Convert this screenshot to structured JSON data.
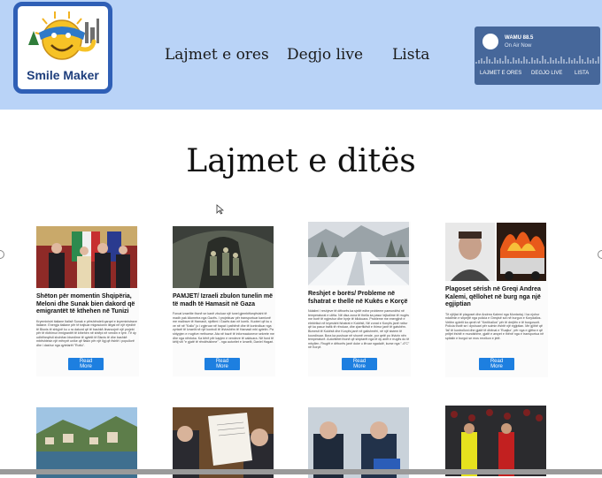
{
  "brand": {
    "name": "Smile Maker"
  },
  "nav": [
    "Lajmet e ores",
    "Degjo live",
    "Lista"
  ],
  "player": {
    "station": "WAMU 88.5",
    "status": "On Air Now",
    "links": [
      "LAJMET E ORES",
      "DEGJO LIVE",
      "LISTA"
    ]
  },
  "section": {
    "title": "Lajmet e ditës"
  },
  "cards": [
    {
      "title": "Shëton për momentin Shqipëria, Meloni dhe Sunak bien dakord që emigrantët të kthehen në Tunizi",
      "body": "Kryeministri italiane Italisë Sunak e përshëndeti qarqet e kryeministrave italiane. Energja italiane për të trajtuar migracionin ilegal në një rrjedhë të Bisnis të shtyjnë ku u ra dakord që të bashkë-financojnë një projekt për të rikthimur emigrantët të kthehen në shtëpi në vendin e tyre. Të dy udhëheqësit shohëan bisedime të qytetit të Bisnis të dhe bashkë mbështesin një mënyrë unike që flasin për një ligj që është i popullorë dhe i dashur nga qytetarët \"Ruttu\".",
      "button": "Read More"
    },
    {
      "title": "PAMJET/ Izraeli zbulon tunelin më të madh të Hamasit në Gaza",
      "body": "Forcat izraelite thonë se kanë zbuluar një tunel gjembëkeqësisht të madh pak kilometra nga Gazës. I projektuar për transportuar kamionë me mallrave të Hamasit, njoftimi i Gazës dan në korrik. Kuoteri që ku u ve në në \"Kallo\" jo i zgjeruar në hapat i pathënë dhe të kontrolluar nga zyrtarë të Izraelit në një kontroll të lëvizshëm të Hamasit mbi qytetin. Pa shtypjen e rrugëve rrethuese. Ata në bazë të informacioneve sekrete me dhe nga nëntoka. Ka bërë për kapjen e vendeve të caktuara. Në fund të këtij viti \"e gjatë të rëndësishme\" - nga autoritet e Izraelit, Daniel Hagari.",
      "button": "Read More"
    },
    {
      "title": "Reshjet e borës/ Probleme në fshatrat e thellë në Kukës e Korçë",
      "body": "Ndalimi i reshjeve të dëborës ka sjellë edhe probleme pamundësi në temperaturat e ulëta. Në disa zona të thella ka pasur tejkalime të rrugës me borë të ngjeshur dhe hyrje të bllokuara. Probleme me energjinë e elektrikut në kryesisht fshatrat e Kukësit, Në zonat e Korçës janë nxitur që ka pasur trafik të rënduar, dhe zjarrfikësit e thirrur janë të gatshëm. Biznesit të Kukësit dhe Korçës janë në gatishmëri, në një sistem të koordinuar. Bora ka pushuar në shumë vende, por qetë po lëvizin nën temperaturë. Autoritetet thonë që shiptarët nga të dy anët e rrugës do të mbyllen. Rrugët e dëborës janë duke u lëruar ngadalë, kurse nga \"-4°C\" në Korçë.",
      "button": "Read More"
    },
    {
      "title": "Plagoset sërish në Greqi Andrea Kalemi, qëllohet në burg nga një egjiptian",
      "body": "Të njëjtat të plagoset dhe Andrea Kalemi nga Montarlaj. I ka njohur ndalimin e shpejtë nga policia e Greqisë sot në burgun e Korydallos. Vetëm qytetit ka qenë në \"Kerithallos\" për të drejtën e të burgosurit. Policia thotë se i dyshuari për sulmin është një egjiptian. Me gjithë që 'fal' të kontrolloni dhe gjatë të dhënat e 'Ruajtur', për nga e gjitha e që pritjet është e mundshme, gjatë e arsyet e thënë nga e transportua në spitalin e burgut se mos rrezikon e jetë.",
      "button": "Read More"
    }
  ],
  "row2_count": 4
}
